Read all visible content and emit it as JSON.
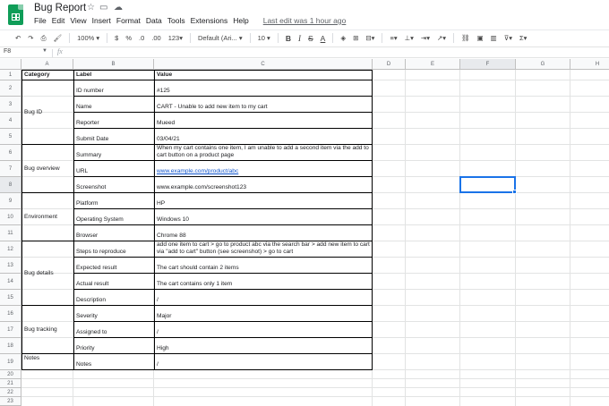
{
  "app": {
    "doc_title": "Bug Report",
    "last_edit": "Last edit was 1 hour ago",
    "menus": [
      "File",
      "Edit",
      "View",
      "Insert",
      "Format",
      "Data",
      "Tools",
      "Extensions",
      "Help"
    ]
  },
  "toolbar": {
    "undo": "↶",
    "redo": "↷",
    "zoom": "100%",
    "currency": "$",
    "percent": "%",
    "decimal_decrease": ".0",
    "decimal_increase": ".00",
    "more_formats": "123",
    "font": "Default (Ari...",
    "font_size": "10",
    "bold": "B",
    "italic": "I",
    "strikethrough": "S",
    "text_color": "A"
  },
  "formula_bar": {
    "name_box": "F8",
    "fx": "fx",
    "value": ""
  },
  "grid": {
    "columns": [
      "A",
      "B",
      "C",
      "D",
      "E",
      "F",
      "G",
      "H"
    ],
    "rows": [
      "1",
      "2",
      "3",
      "4",
      "5",
      "6",
      "7",
      "8",
      "9",
      "10",
      "11",
      "12",
      "13",
      "14",
      "15",
      "16",
      "17",
      "18",
      "19",
      "20",
      "21",
      "22",
      "23"
    ],
    "selected_cell": "F8",
    "headers": {
      "category": "Category",
      "label": "Label",
      "value": "Value"
    },
    "categories": {
      "bug_id": "Bug ID",
      "bug_overview": "Bug overview",
      "environment": "Environment",
      "bug_details": "Bug details",
      "bug_tracking": "Bug tracking",
      "notes": "Notes"
    },
    "rows_data": [
      {
        "label": "ID number",
        "value": "#125"
      },
      {
        "label": "Name",
        "value": "CART - Unable to add new item to my cart"
      },
      {
        "label": "Reporter",
        "value": "Mueed"
      },
      {
        "label": "Submit Date",
        "value": "03/04/21"
      },
      {
        "label": "Summary",
        "value": "When my cart contains one item, I am unable to add a second item via the add to cart button on a product page"
      },
      {
        "label": "URL",
        "value": "www.example.com/product/abc"
      },
      {
        "label": "Screenshot",
        "value": "www.example.com/screenshot123"
      },
      {
        "label": "Platform",
        "value": "HP"
      },
      {
        "label": "Operating System",
        "value": "Windows 10"
      },
      {
        "label": "Browser",
        "value": "Chrome 88"
      },
      {
        "label": "Steps to reproduce",
        "value": "add one item to cart > go to product abc via the search bar > add new item to cart via \"add to cart\" button (see screenshot) > go to cart"
      },
      {
        "label": "Expected result",
        "value": "The cart should contain 2 items"
      },
      {
        "label": "Actual result",
        "value": "The cart contains only 1 item"
      },
      {
        "label": "Description",
        "value": "/"
      },
      {
        "label": "Severity",
        "value": "Major"
      },
      {
        "label": "Assigned to",
        "value": "/"
      },
      {
        "label": "Priority",
        "value": "High"
      },
      {
        "label": "Notes",
        "value": "/"
      }
    ]
  },
  "colors": {
    "brand": "#0f9d58",
    "selection": "#1a73e8",
    "link": "#1155cc"
  }
}
